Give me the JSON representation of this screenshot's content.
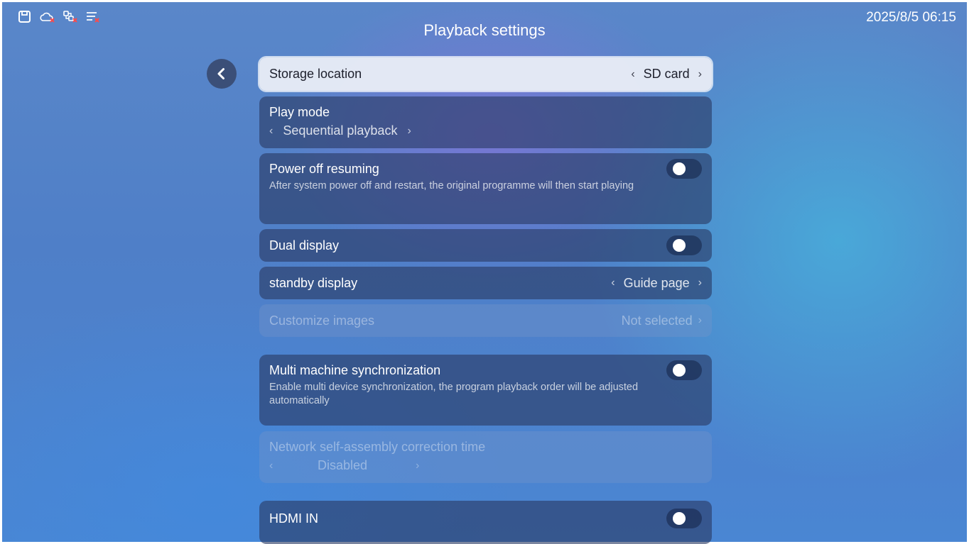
{
  "status_bar": {
    "icons": [
      "storage-icon",
      "cloud-disconnected-icon",
      "network-disconnected-icon",
      "list-error-icon"
    ],
    "time": "2025/8/5 06:15"
  },
  "page": {
    "title": "Playback settings",
    "back_icon": "chevron-left-icon"
  },
  "settings": {
    "storage_location": {
      "label": "Storage location",
      "value": "SD card",
      "prev": "‹",
      "next": "›"
    },
    "play_mode": {
      "label": "Play mode",
      "value": "Sequential playback",
      "prev": "‹",
      "next": "›"
    },
    "power_off_resuming": {
      "label": "Power off resuming",
      "description": "After system power off and restart, the original programme will then start playing",
      "enabled": false
    },
    "dual_display": {
      "label": "Dual display",
      "enabled": false
    },
    "standby_display": {
      "label": "standby display",
      "value": "Guide page",
      "prev": "‹",
      "next": "›"
    },
    "customize_images": {
      "label": "Customize images",
      "value": "Not selected",
      "next": "›"
    },
    "multi_machine_sync": {
      "label": "Multi machine synchronization",
      "description": "Enable multi device synchronization, the program playback order will be adjusted automatically",
      "enabled": false
    },
    "network_correction_time": {
      "label": "Network self-assembly correction time",
      "value": "Disabled",
      "prev": "‹",
      "next": "›"
    },
    "hdmi_in": {
      "label": "HDMI IN",
      "enabled": false
    }
  }
}
